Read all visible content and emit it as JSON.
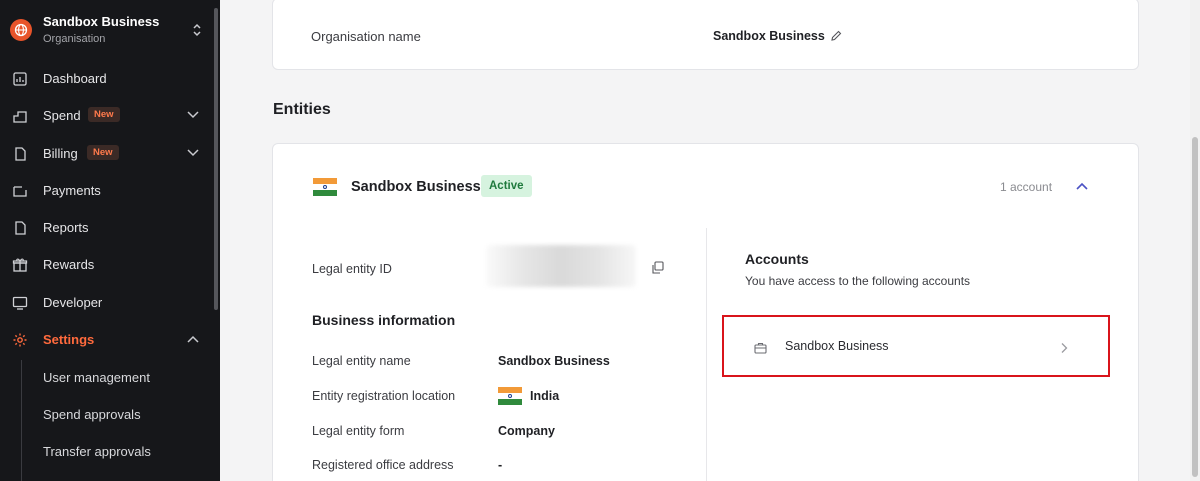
{
  "sidebar": {
    "org_name": "Sandbox Business",
    "org_subtitle": "Organisation",
    "items": [
      {
        "label": "Dashboard"
      },
      {
        "label": "Spend",
        "badge": "New"
      },
      {
        "label": "Billing",
        "badge": "New"
      },
      {
        "label": "Payments"
      },
      {
        "label": "Reports"
      },
      {
        "label": "Rewards"
      },
      {
        "label": "Developer"
      },
      {
        "label": "Settings"
      }
    ],
    "settings_sub": [
      {
        "label": "User management"
      },
      {
        "label": "Spend approvals"
      },
      {
        "label": "Transfer approvals"
      }
    ],
    "accent": "#ff6a3d"
  },
  "org_card": {
    "label": "Organisation name",
    "value": "Sandbox Business"
  },
  "entities": {
    "title": "Entities",
    "entity": {
      "name": "Sandbox Business",
      "status": "Active",
      "account_count": "1 account",
      "legal_entity_id_label": "Legal entity ID",
      "business_info_title": "Business information",
      "fields": [
        {
          "label": "Legal entity name",
          "value": "Sandbox Business"
        },
        {
          "label": "Entity registration location",
          "value": "India"
        },
        {
          "label": "Legal entity form",
          "value": "Company"
        },
        {
          "label": "Registered office address",
          "value": "-"
        }
      ]
    },
    "accounts": {
      "title": "Accounts",
      "subtitle": "You have access to the following accounts",
      "items": [
        {
          "name": "Sandbox Business"
        }
      ]
    }
  }
}
